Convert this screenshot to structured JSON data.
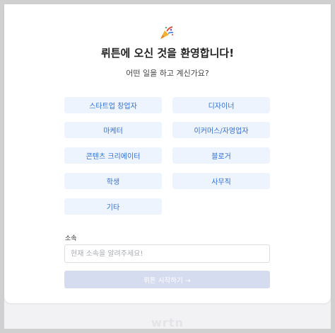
{
  "header": {
    "title": "뤼튼에 오신 것을 환영합니다!",
    "subtitle": "어떤 일을 하고 계신가요?"
  },
  "options": [
    "스타트업 창업자",
    "디자이너",
    "마케터",
    "이커머스/자영업자",
    "콘텐츠 크리에이터",
    "블로거",
    "학생",
    "사무직",
    "기타"
  ],
  "affiliation": {
    "label": "소속",
    "placeholder": "현재 소속을 알려주세요!",
    "value": ""
  },
  "start_button": {
    "label": "뤼튼 시작하기 →"
  },
  "footer": {
    "logo": "wrtn"
  },
  "colors": {
    "option_bg": "#eef4fd",
    "option_text": "#2f6fd6",
    "button_disabled_bg": "#d6dcf0"
  }
}
